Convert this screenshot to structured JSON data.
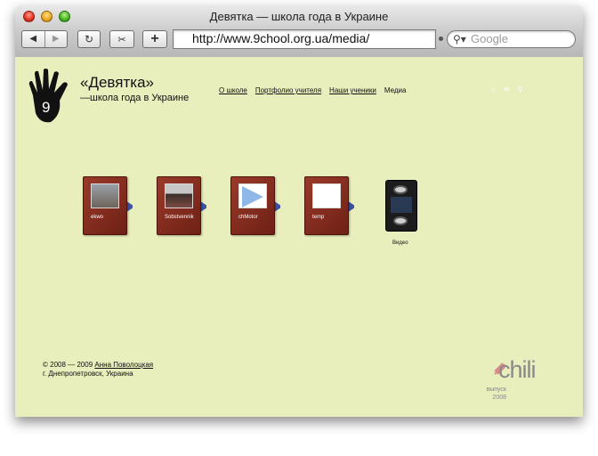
{
  "window": {
    "title": "Девятка — школа года в Украине"
  },
  "toolbar": {
    "back_icon": "back-arrow-icon",
    "forward_icon": "forward-arrow-icon",
    "reload_icon": "reload-icon",
    "clip_icon": "web-clip-icon",
    "add_label": "+",
    "url": "http://www.9chool.org.ua/media/",
    "search_placeholder": "Google"
  },
  "site": {
    "logo_number": "9",
    "title": "«Девятка»",
    "subtitle": "—школа года в Украине",
    "menu": [
      {
        "label": "О школе"
      },
      {
        "label": "Портфолио учителя"
      },
      {
        "label": "Наши ученики"
      },
      {
        "label": "Медиа"
      }
    ],
    "icons": [
      "home-icon",
      "mail-icon",
      "search-icon"
    ]
  },
  "albums": [
    {
      "label": "ekwo"
    },
    {
      "label": "Sobstvennik"
    },
    {
      "label": "chMotor"
    },
    {
      "label": "temp"
    }
  ],
  "video": {
    "label": "Видео"
  },
  "footer": {
    "copyright_prefix": "© 2008 — 2009",
    "author_link": "Анна Поволоцкая",
    "location": "г. Днепропетровск, Украина"
  },
  "chili": {
    "logo_text": "chili",
    "release_label": "выпуск",
    "release_year": "2008"
  }
}
